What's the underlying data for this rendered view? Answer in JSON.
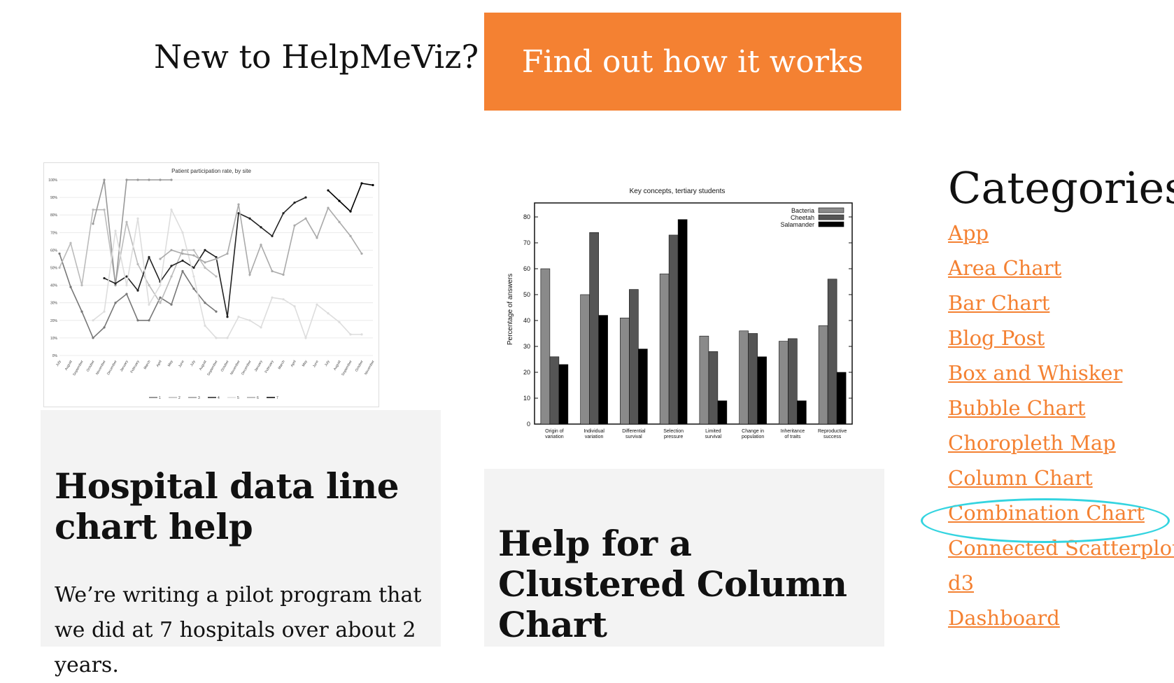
{
  "hero": {
    "prompt": "New to HelpMeViz?",
    "button_label": "Find out how it works",
    "button_color": "#f48132"
  },
  "posts": [
    {
      "title": "Hospital data line chart help",
      "excerpt": "We’re writing a pilot program that we did at 7 hospitals over about 2 years.",
      "thumbnail": {
        "title": "Patient participation rate, by site",
        "y_ticks": [
          "100%",
          "90%",
          "80%",
          "70%",
          "60%",
          "50%",
          "40%",
          "30%",
          "20%",
          "10%",
          "0%"
        ],
        "x_ticks": [
          "July",
          "August",
          "September",
          "October",
          "November",
          "December",
          "January",
          "February",
          "March",
          "April",
          "May",
          "June",
          "July",
          "August",
          "September",
          "October",
          "November",
          "December",
          "January",
          "February",
          "March",
          "April",
          "May",
          "June",
          "July",
          "August",
          "September",
          "October",
          "November"
        ],
        "legend": [
          "1",
          "2",
          "3",
          "4",
          "5",
          "6",
          "7"
        ]
      }
    },
    {
      "title": "Help for a Clustered Column Chart",
      "thumbnail": {
        "title": "Key concepts, tertiary students",
        "ylabel": "Percentage of answers",
        "y_ticks": [
          "80",
          "70",
          "60",
          "50",
          "40",
          "30",
          "20",
          "10",
          "0"
        ],
        "legend": [
          "Bacteria",
          "Cheetah",
          "Salamander"
        ],
        "categories": [
          [
            "Origin of",
            "variation"
          ],
          [
            "Individual",
            "variation"
          ],
          [
            "Differential",
            "survival"
          ],
          [
            "Selection",
            "pressure"
          ],
          [
            "Limited",
            "survival"
          ],
          [
            "Change in",
            "population"
          ],
          [
            "Inheritance",
            "of traits"
          ],
          [
            "Reproductive",
            "success"
          ]
        ]
      }
    }
  ],
  "categories": {
    "heading": "Categories",
    "items": [
      "App",
      "Area Chart",
      "Bar Chart",
      "Blog Post",
      "Box and Whisker",
      "Bubble Chart",
      "Choropleth Map",
      "Column Chart",
      "Combination Chart",
      "Connected Scatterplot",
      "d3",
      "Dashboard"
    ],
    "highlighted": "Combination Chart",
    "link_color": "#f48132",
    "highlight_color": "#34d4e0"
  },
  "chart_data": [
    {
      "type": "bar",
      "title": "Key concepts, tertiary students",
      "ylabel": "Percentage of answers",
      "ylim": [
        0,
        80
      ],
      "categories": [
        "Origin of variation",
        "Individual variation",
        "Differential survival",
        "Selection pressure",
        "Limited survival",
        "Change in population",
        "Inheritance of traits",
        "Reproductive success"
      ],
      "series": [
        {
          "name": "Bacteria",
          "values": [
            60,
            50,
            41,
            58,
            34,
            36,
            32,
            38
          ],
          "color": "#8a8a8a"
        },
        {
          "name": "Cheetah",
          "values": [
            26,
            74,
            52,
            73,
            28,
            35,
            33,
            56
          ],
          "color": "#555555"
        },
        {
          "name": "Salamander",
          "values": [
            23,
            42,
            29,
            79,
            9,
            26,
            9,
            20
          ],
          "color": "#000000"
        }
      ]
    },
    {
      "type": "line",
      "title": "Patient participation rate, by site",
      "ylim": [
        0,
        100
      ],
      "series": [
        {
          "name": "1",
          "color": "#777777",
          "values": [
            58,
            39,
            25,
            10,
            16,
            30,
            35,
            20,
            20,
            33,
            29,
            48,
            38,
            30,
            25
          ]
        },
        {
          "name": "2",
          "color": "#bbbbbb",
          "values": [
            50,
            64,
            40,
            83,
            83,
            41,
            76,
            52,
            40,
            30,
            45,
            60,
            60,
            50,
            45
          ]
        },
        {
          "name": "3",
          "color": "#999999",
          "values": [
            75,
            100,
            40,
            100,
            100,
            100,
            100,
            100
          ]
        },
        {
          "name": "4",
          "color": "#222222",
          "values": [
            44,
            41,
            45,
            37,
            56,
            42,
            51,
            54,
            50,
            60,
            56,
            22,
            81,
            78,
            73,
            68,
            81,
            87,
            90
          ]
        },
        {
          "name": "5",
          "color": "#dddddd",
          "values": [
            20,
            25,
            71,
            40,
            78,
            29,
            40,
            83,
            70,
            45,
            17,
            10,
            10,
            22,
            20,
            16,
            33,
            32,
            28,
            10,
            29,
            24,
            19,
            12,
            12
          ]
        },
        {
          "name": "6",
          "color": "#aaaaaa",
          "values": [
            55,
            60,
            58,
            57,
            53,
            55,
            58,
            86,
            46,
            63,
            48,
            46,
            74,
            78,
            67,
            84,
            76,
            68,
            58
          ]
        },
        {
          "name": "7",
          "color": "#000000",
          "values": [
            94,
            88,
            82,
            98,
            97
          ]
        }
      ]
    }
  ]
}
